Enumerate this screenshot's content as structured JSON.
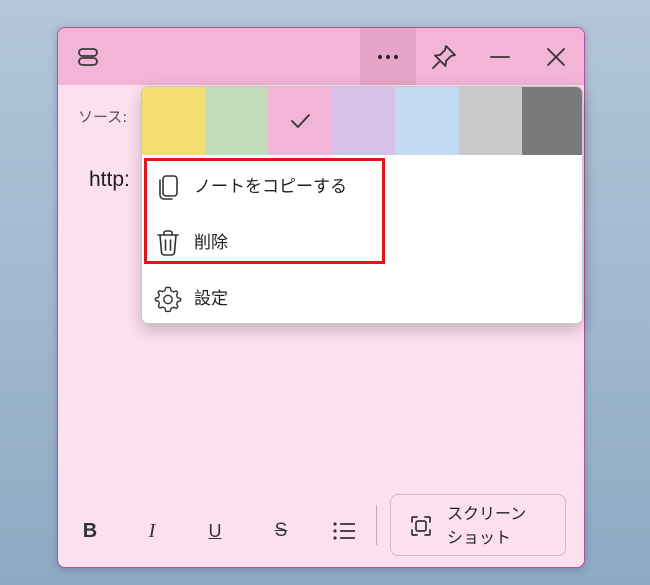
{
  "note": {
    "source_label": "ソース:",
    "body_text": "http:"
  },
  "titlebar": {
    "menu_icon": "hamburger-icon",
    "more_label": "···",
    "pin_icon": "pin-icon",
    "minimize_icon": "minimize-icon",
    "close_icon": "close-icon"
  },
  "color_menu": {
    "swatches": [
      {
        "color": "#f2dd6e",
        "selected": false
      },
      {
        "color": "#c1dcba",
        "selected": false
      },
      {
        "color": "#f2b4d7",
        "selected": true
      },
      {
        "color": "#d5c1ea",
        "selected": false
      },
      {
        "color": "#c2dbf3",
        "selected": false
      },
      {
        "color": "#c9c9c9",
        "selected": false
      },
      {
        "color": "#7a7a7a",
        "selected": false
      }
    ],
    "items": [
      {
        "label": "ノートをコピーする",
        "icon": "copy-icon"
      },
      {
        "label": "削除",
        "icon": "trash-icon"
      },
      {
        "label": "設定",
        "icon": "gear-icon"
      }
    ]
  },
  "toolbar": {
    "bold": "B",
    "italic": "I",
    "underline": "U",
    "strikethrough": "S",
    "screenshot_label": "スクリーン\nショット"
  },
  "colors": {
    "note_background": "#fde0ef",
    "titlebar": "#f2b4d7",
    "highlight": "#e0161b"
  }
}
